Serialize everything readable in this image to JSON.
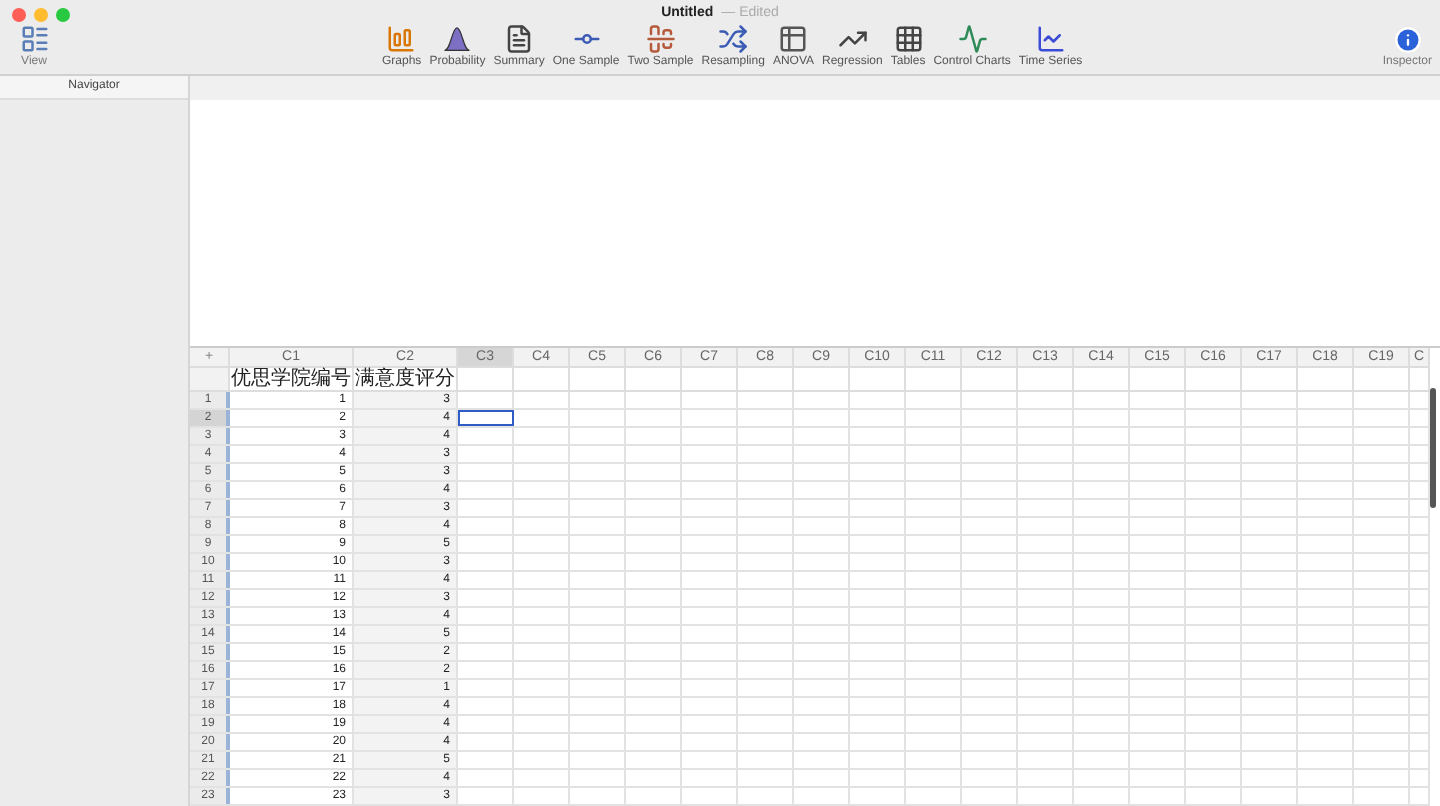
{
  "window": {
    "title": "Untitled",
    "subtitle": "— Edited"
  },
  "toolbar": {
    "view": "View",
    "tools": [
      "Graphs",
      "Probability",
      "Summary",
      "One Sample",
      "Two Sample",
      "Resampling",
      "ANOVA",
      "Regression",
      "Tables",
      "Control Charts",
      "Time Series"
    ],
    "inspector": "Inspector"
  },
  "navigator": {
    "title": "Navigator"
  },
  "worksheet": {
    "corner": "+",
    "columns": [
      {
        "label": "C1",
        "name": "优思学院编号",
        "selected": false
      },
      {
        "label": "C2",
        "name": "满意度评分",
        "selected": false
      },
      {
        "label": "C3",
        "selected": true
      },
      {
        "label": "C4",
        "selected": false
      },
      {
        "label": "C5",
        "selected": false
      },
      {
        "label": "C6",
        "selected": false
      },
      {
        "label": "C7",
        "selected": false
      },
      {
        "label": "C8",
        "selected": false
      },
      {
        "label": "C9",
        "selected": false
      },
      {
        "label": "C10",
        "selected": false
      },
      {
        "label": "C11",
        "selected": false
      },
      {
        "label": "C12",
        "selected": false
      },
      {
        "label": "C13",
        "selected": false
      },
      {
        "label": "C14",
        "selected": false
      },
      {
        "label": "C15",
        "selected": false
      },
      {
        "label": "C16",
        "selected": false
      },
      {
        "label": "C17",
        "selected": false
      },
      {
        "label": "C18",
        "selected": false
      },
      {
        "label": "C19",
        "selected": false
      },
      {
        "label": "C",
        "selected": false
      }
    ],
    "rows": [
      {
        "number": "1",
        "c1": "1",
        "c2": "3",
        "selected": false
      },
      {
        "number": "2",
        "c1": "2",
        "c2": "4",
        "selected": true
      },
      {
        "number": "3",
        "c1": "3",
        "c2": "4",
        "selected": false
      },
      {
        "number": "4",
        "c1": "4",
        "c2": "3",
        "selected": false
      },
      {
        "number": "5",
        "c1": "5",
        "c2": "3",
        "selected": false
      },
      {
        "number": "6",
        "c1": "6",
        "c2": "4",
        "selected": false
      },
      {
        "number": "7",
        "c1": "7",
        "c2": "3",
        "selected": false
      },
      {
        "number": "8",
        "c1": "8",
        "c2": "4",
        "selected": false
      },
      {
        "number": "9",
        "c1": "9",
        "c2": "5",
        "selected": false
      },
      {
        "number": "10",
        "c1": "10",
        "c2": "3",
        "selected": false
      },
      {
        "number": "11",
        "c1": "11",
        "c2": "4",
        "selected": false
      },
      {
        "number": "12",
        "c1": "12",
        "c2": "3",
        "selected": false
      },
      {
        "number": "13",
        "c1": "13",
        "c2": "4",
        "selected": false
      },
      {
        "number": "14",
        "c1": "14",
        "c2": "5",
        "selected": false
      },
      {
        "number": "15",
        "c1": "15",
        "c2": "2",
        "selected": false
      },
      {
        "number": "16",
        "c1": "16",
        "c2": "2",
        "selected": false
      },
      {
        "number": "17",
        "c1": "17",
        "c2": "1",
        "selected": false
      },
      {
        "number": "18",
        "c1": "18",
        "c2": "4",
        "selected": false
      },
      {
        "number": "19",
        "c1": "19",
        "c2": "4",
        "selected": false
      },
      {
        "number": "20",
        "c1": "20",
        "c2": "4",
        "selected": false
      },
      {
        "number": "21",
        "c1": "21",
        "c2": "5",
        "selected": false
      },
      {
        "number": "22",
        "c1": "22",
        "c2": "4",
        "selected": false
      },
      {
        "number": "23",
        "c1": "23",
        "c2": "3",
        "selected": false
      }
    ]
  }
}
